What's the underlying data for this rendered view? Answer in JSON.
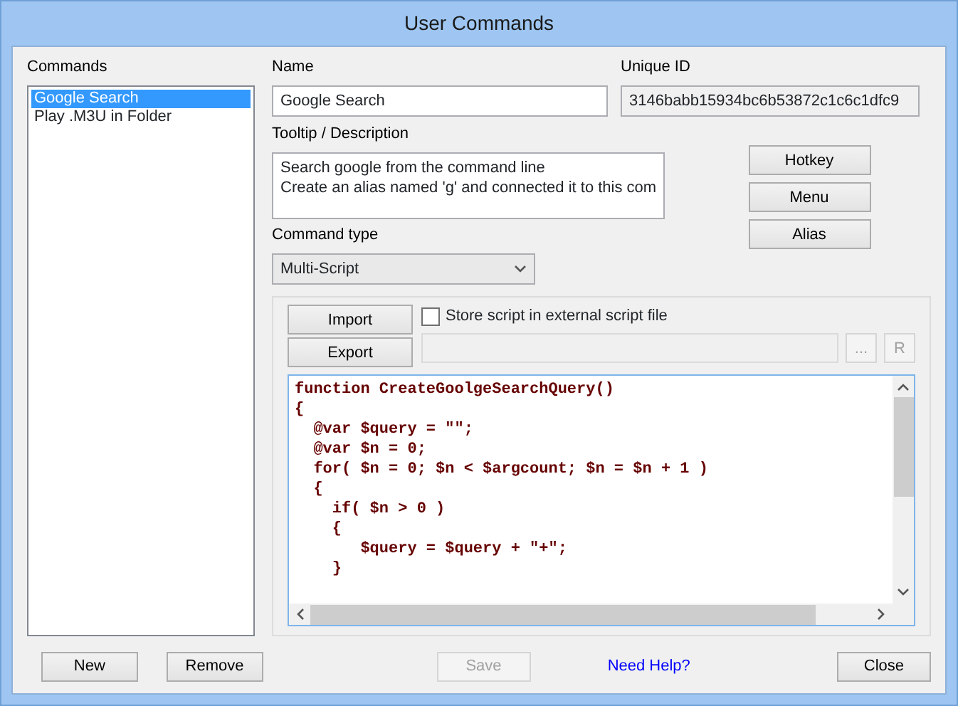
{
  "window": {
    "title": "User Commands"
  },
  "commands": {
    "label": "Commands",
    "items": [
      {
        "text": "Google Search",
        "selected": true
      },
      {
        "text": "Play .M3U in Folder",
        "selected": false
      }
    ]
  },
  "name": {
    "label": "Name",
    "value": "Google Search"
  },
  "unique_id": {
    "label": "Unique ID",
    "value": "3146babb15934bc6b53872c1c6c1dfc9"
  },
  "tooltip": {
    "label": "Tooltip / Description",
    "lines": [
      "Search google from the command line",
      "Create an alias named 'g' and connected it to this com"
    ]
  },
  "side_buttons": [
    {
      "text": "Hotkey",
      "disabled": false
    },
    {
      "text": "Menu",
      "disabled": false
    },
    {
      "text": "Alias",
      "disabled": false
    }
  ],
  "command_type": {
    "label": "Command type",
    "value": "Multi-Script"
  },
  "script": {
    "import": "Import",
    "export": "Export",
    "store_external": {
      "label": "Store script in external script file",
      "checked": false
    },
    "browse_button": {
      "text": "...",
      "disabled": true
    },
    "reload_button": {
      "text": "R",
      "disabled": true
    },
    "code_lines": [
      "function CreateGoolgeSearchQuery()",
      "{",
      "  @var $query = \"\";",
      "  @var $n = 0;",
      "  for( $n = 0; $n < $argcount; $n = $n + 1 )",
      "  {",
      "    if( $n > 0 )",
      "    {",
      "       $query = $query + \"+\";",
      "    }"
    ]
  },
  "footer_buttons": [
    {
      "kind": "button",
      "text": "New",
      "disabled": false
    },
    {
      "kind": "button",
      "text": "Remove",
      "disabled": false
    },
    {
      "kind": "button",
      "text": "Save",
      "disabled": true
    },
    {
      "kind": "link",
      "text": "Need Help?",
      "disabled": false
    },
    {
      "kind": "button",
      "text": "Close",
      "disabled": false
    }
  ]
}
